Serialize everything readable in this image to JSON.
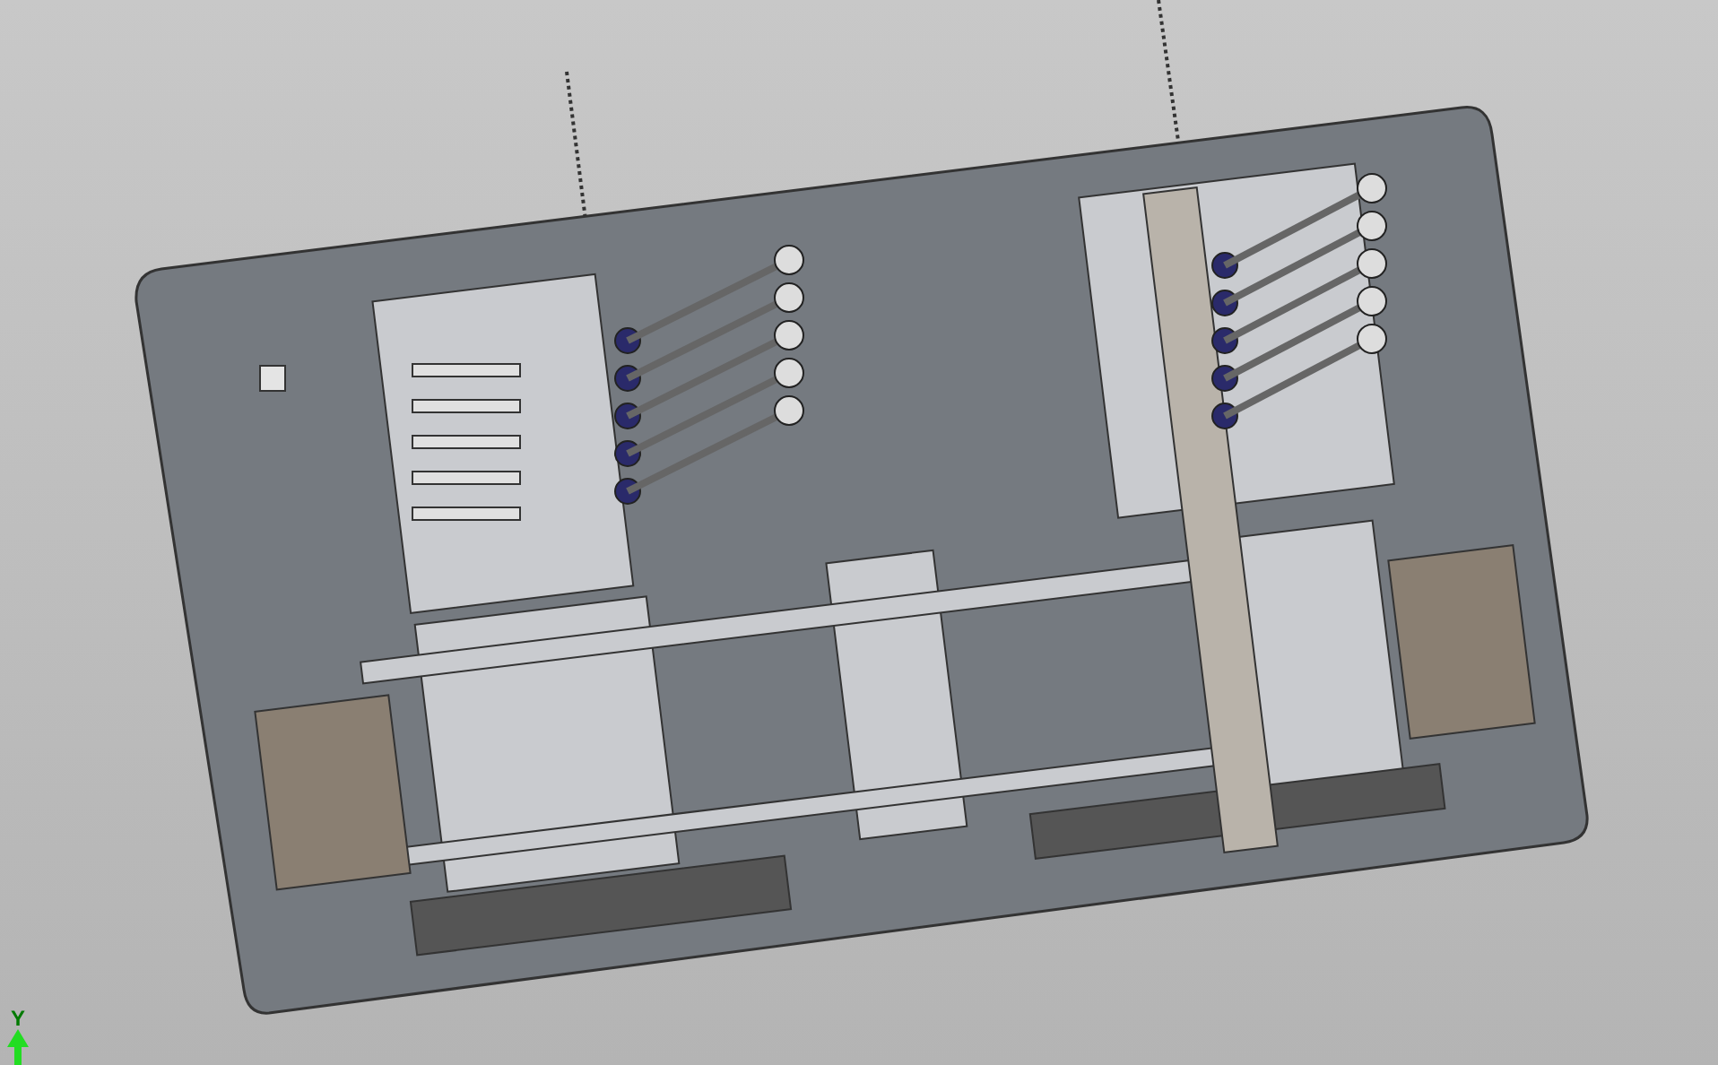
{
  "viewport": {
    "triad": {
      "axis_label": "Y"
    }
  }
}
